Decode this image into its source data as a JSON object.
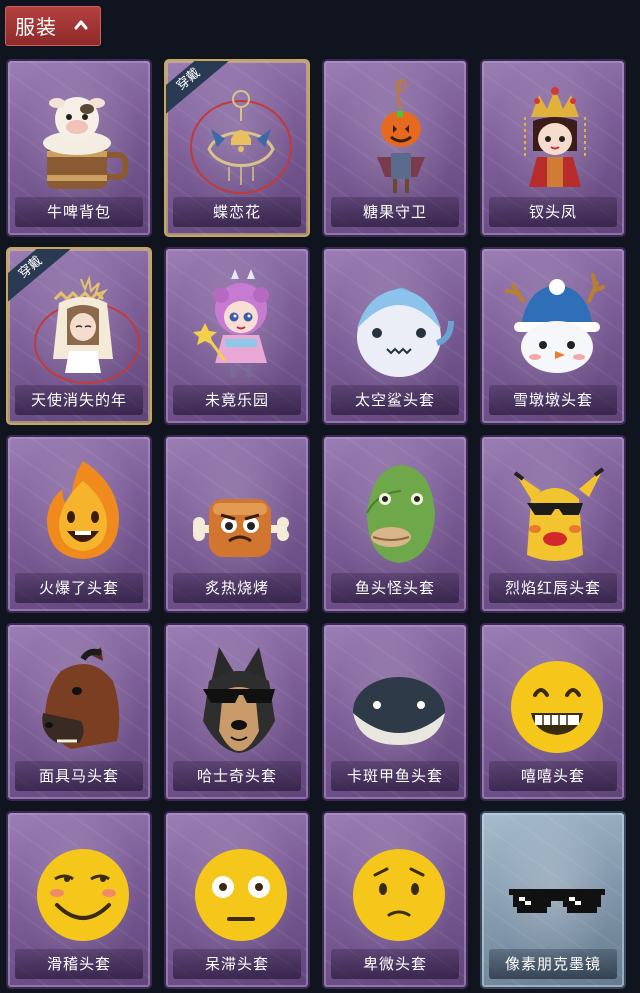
{
  "header": {
    "title": "服装",
    "toggle_icon": "chevron-up-icon"
  },
  "badge_text": "穿戴",
  "items": [
    {
      "name": "牛啤背包",
      "icon": "cow-beer-barrel-icon"
    },
    {
      "name": "蝶恋花",
      "icon": "butterfly-bell-ornament-icon",
      "equipped": true
    },
    {
      "name": "糖果守卫",
      "icon": "pumpkin-scarecrow-icon"
    },
    {
      "name": "钗头凤",
      "icon": "phoenix-crown-doll-icon"
    },
    {
      "name": "天使消失的年",
      "icon": "angel-doll-icon",
      "equipped": true
    },
    {
      "name": "未竟乐园",
      "icon": "pink-hair-doll-icon"
    },
    {
      "name": "太空鲨头套",
      "icon": "space-shark-head-icon"
    },
    {
      "name": "雪墩墩头套",
      "icon": "snowman-head-icon"
    },
    {
      "name": "火爆了头套",
      "icon": "fire-face-head-icon"
    },
    {
      "name": "炙热烧烤",
      "icon": "bbq-meat-head-icon"
    },
    {
      "name": "鱼头怪头套",
      "icon": "fish-head-icon"
    },
    {
      "name": "烈焰红唇头套",
      "icon": "yellow-mask-sunglasses-icon"
    },
    {
      "name": "面具马头套",
      "icon": "horse-head-icon"
    },
    {
      "name": "哈士奇头套",
      "icon": "husky-head-icon"
    },
    {
      "name": "卡斑甲鱼头套",
      "icon": "turtle-head-icon"
    },
    {
      "name": "嘻嘻头套",
      "icon": "grin-emoji-head-icon"
    },
    {
      "name": "滑稽头套",
      "icon": "funny-emoji-head-icon"
    },
    {
      "name": "呆滞头套",
      "icon": "dazed-emoji-head-icon"
    },
    {
      "name": "卑微头套",
      "icon": "humble-emoji-head-icon"
    },
    {
      "name": "像素朋克墨镜",
      "icon": "pixel-sunglasses-icon",
      "special": true
    }
  ]
}
